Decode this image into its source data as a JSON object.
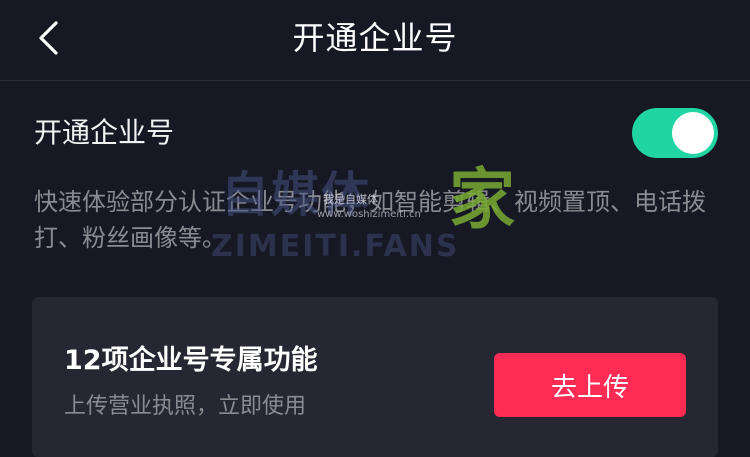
{
  "header": {
    "title": "开通企业号",
    "back_icon": "chevron-left-icon"
  },
  "setting": {
    "label": "开通企业号",
    "toggle_on": true,
    "description": "快速体验部分认证企业号功能，如智能剪辑、视频置顶、电话拨打、粉丝画像等。"
  },
  "card": {
    "title": "12项企业号专属功能",
    "subtitle": "上传营业执照，立即使用",
    "button_label": "去上传"
  },
  "watermark": {
    "main": "自媒体",
    "jia": "家",
    "small": "我是自媒体",
    "url": "www.woshizimeiti.cn",
    "english": "ZIMEITI.FANS"
  },
  "colors": {
    "background": "#161823",
    "toggle_active": "#20d5a3",
    "primary_button": "#fe2c55",
    "card_background": "#262732",
    "secondary_text": "#8a8b92"
  }
}
